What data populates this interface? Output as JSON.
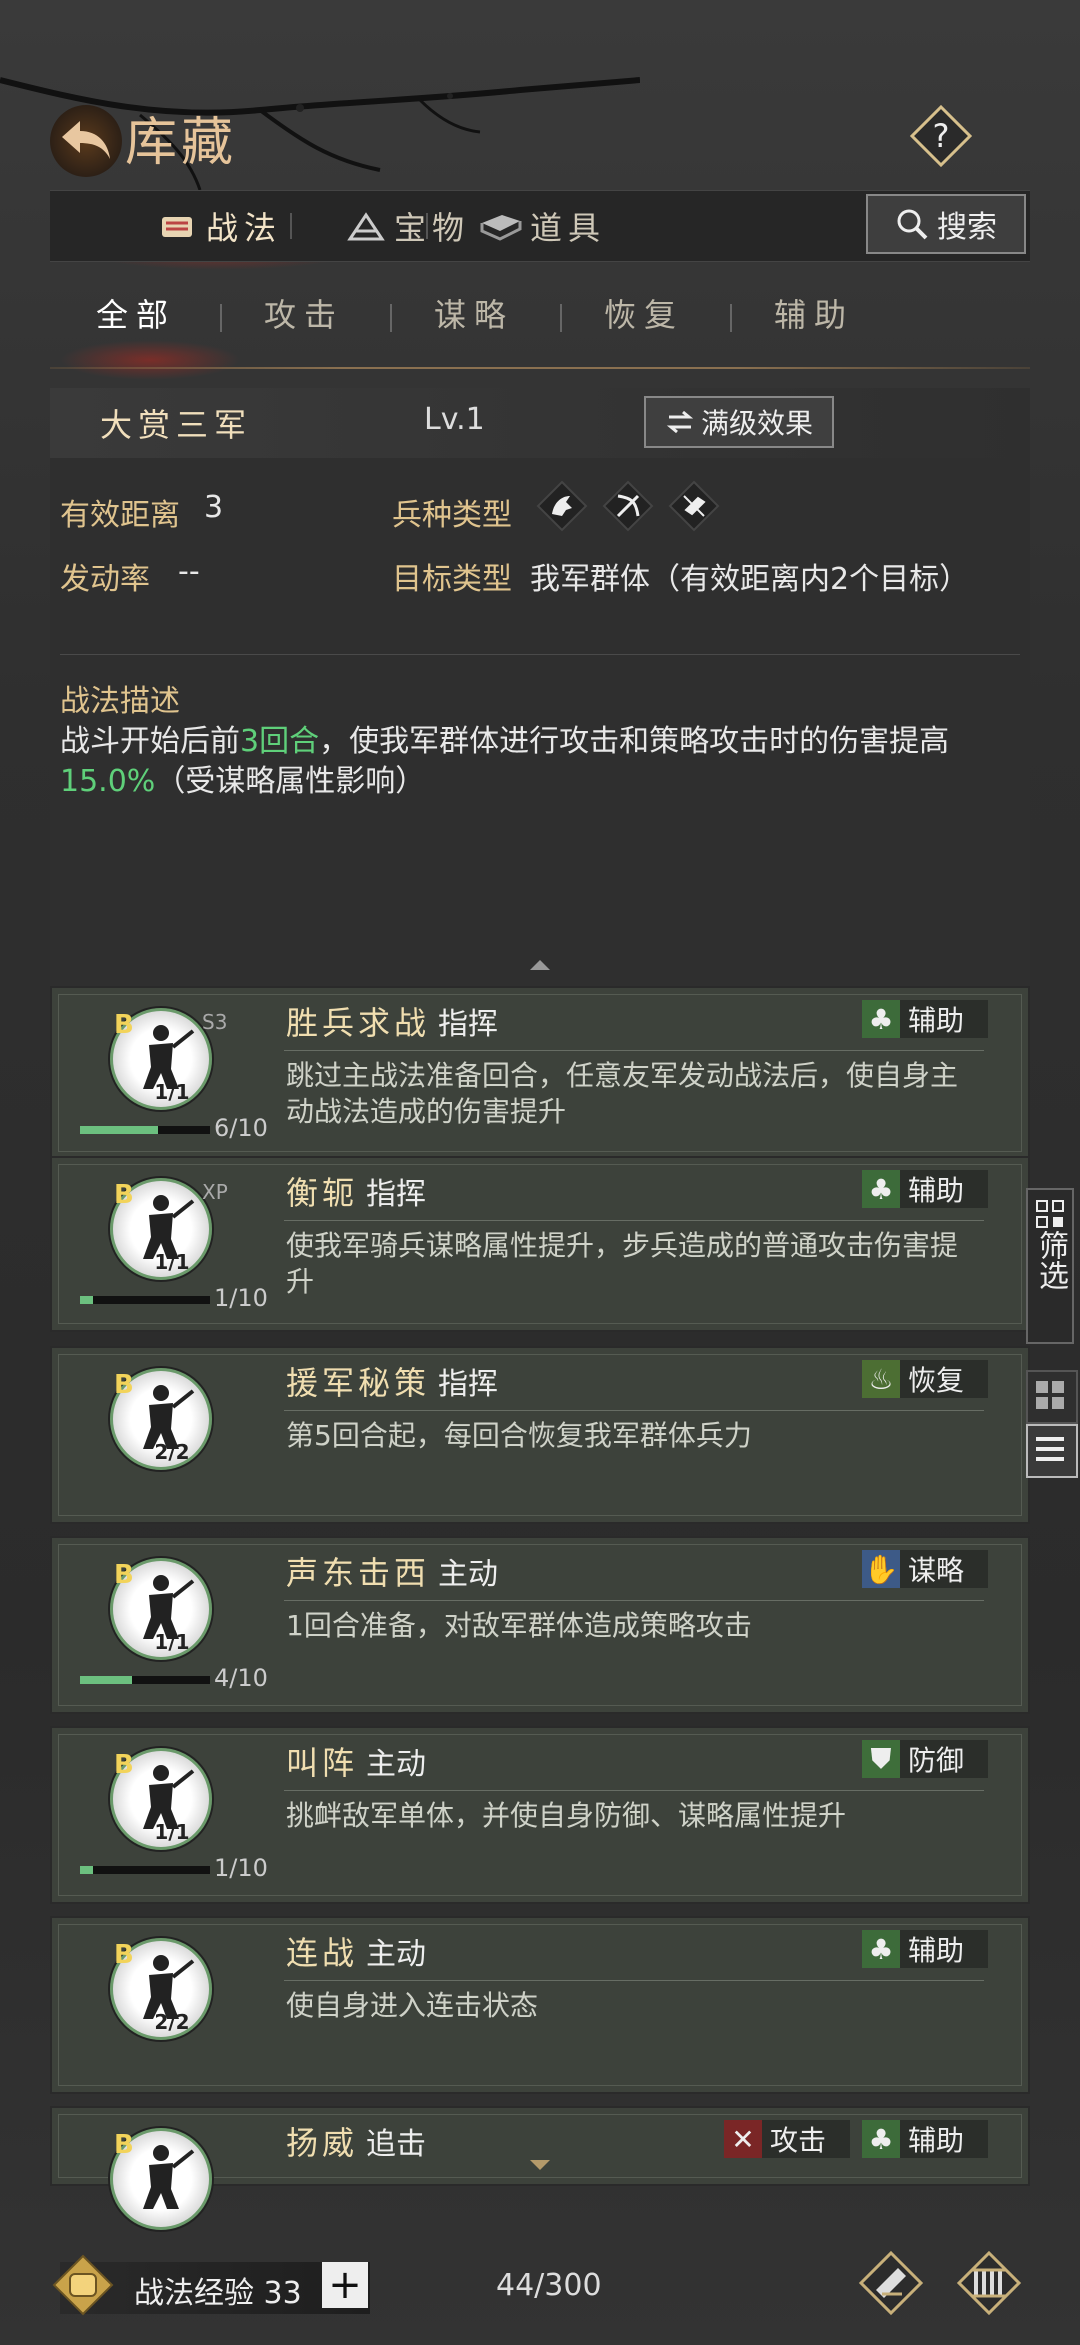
{
  "header": {
    "title": "库藏",
    "help": "?"
  },
  "tabs": [
    {
      "label": "战法"
    },
    {
      "label": "宝物"
    },
    {
      "label": "道具"
    }
  ],
  "search": {
    "label": "搜索"
  },
  "subtabs": [
    {
      "label": "全部"
    },
    {
      "label": "攻击"
    },
    {
      "label": "谋略"
    },
    {
      "label": "恢复"
    },
    {
      "label": "辅助"
    }
  ],
  "detail": {
    "name": "大赏三军",
    "level": "Lv.1",
    "max_effect_label": "满级效果",
    "range_label": "有效距离",
    "range_value": "3",
    "troop_label": "兵种类型",
    "rate_label": "发动率",
    "rate_value": "--",
    "target_label": "目标类型",
    "target_value": "我军群体（有效距离内2个目标）",
    "desc_title": "战法描述",
    "desc_part1": "战斗开始后前",
    "desc_hl1": "3回合",
    "desc_part2": "，使我军群体进行攻击和策略攻击时的伤害提高",
    "desc_hl2": "15.0%",
    "desc_part3": "（受谋略属性影响）"
  },
  "cards": [
    {
      "grade": "B",
      "tag": "S3",
      "count": "1/1",
      "progress": "6/10",
      "progress_fraction": 0.6,
      "name": "胜兵求战",
      "type": "指挥",
      "badges": [
        {
          "label": "辅助",
          "kind": "assist"
        }
      ],
      "desc": "跳过主战法准备回合，任意友军发动战法后，使自身主动战法造成的伤害提升"
    },
    {
      "grade": "B",
      "tag": "XP",
      "count": "1/1",
      "progress": "1/10",
      "progress_fraction": 0.1,
      "name": "衡轭",
      "type": "指挥",
      "badges": [
        {
          "label": "辅助",
          "kind": "assist"
        }
      ],
      "desc": "使我军骑兵谋略属性提升，步兵造成的普通攻击伤害提升"
    },
    {
      "grade": "B",
      "tag": "",
      "count": "2/2",
      "progress": "",
      "name": "援军秘策",
      "type": "指挥",
      "badges": [
        {
          "label": "恢复",
          "kind": "heal"
        }
      ],
      "desc": "第5回合起，每回合恢复我军群体兵力"
    },
    {
      "grade": "B",
      "tag": "",
      "count": "1/1",
      "progress": "4/10",
      "progress_fraction": 0.4,
      "name": "声东击西",
      "type": "主动",
      "badges": [
        {
          "label": "谋略",
          "kind": "strategy"
        }
      ],
      "desc": "1回合准备，对敌军群体造成策略攻击"
    },
    {
      "grade": "B",
      "tag": "",
      "count": "1/1",
      "progress": "1/10",
      "progress_fraction": 0.1,
      "name": "叫阵",
      "type": "主动",
      "badges": [
        {
          "label": "防御",
          "kind": "defense"
        }
      ],
      "desc": "挑衅敌军单体，并使自身防御、谋略属性提升"
    },
    {
      "grade": "B",
      "tag": "",
      "count": "2/2",
      "progress": "",
      "name": "连战",
      "type": "主动",
      "badges": [
        {
          "label": "辅助",
          "kind": "assist"
        }
      ],
      "desc": "使自身进入连击状态"
    },
    {
      "grade": "B",
      "tag": "",
      "count": "",
      "progress": "",
      "name": "扬威",
      "type": "追击",
      "badges": [
        {
          "label": "攻击",
          "kind": "attack"
        },
        {
          "label": "辅助",
          "kind": "assist"
        }
      ],
      "desc": ""
    }
  ],
  "side": {
    "filter_label": "筛选"
  },
  "footer": {
    "exp_label": "战法经验",
    "exp_value": "33",
    "plus": "+",
    "capacity": "44/300"
  },
  "colors": {
    "accent_green": "#5fd07a",
    "gold_text": "#e0c48e",
    "card_bg": "#3d423b"
  }
}
